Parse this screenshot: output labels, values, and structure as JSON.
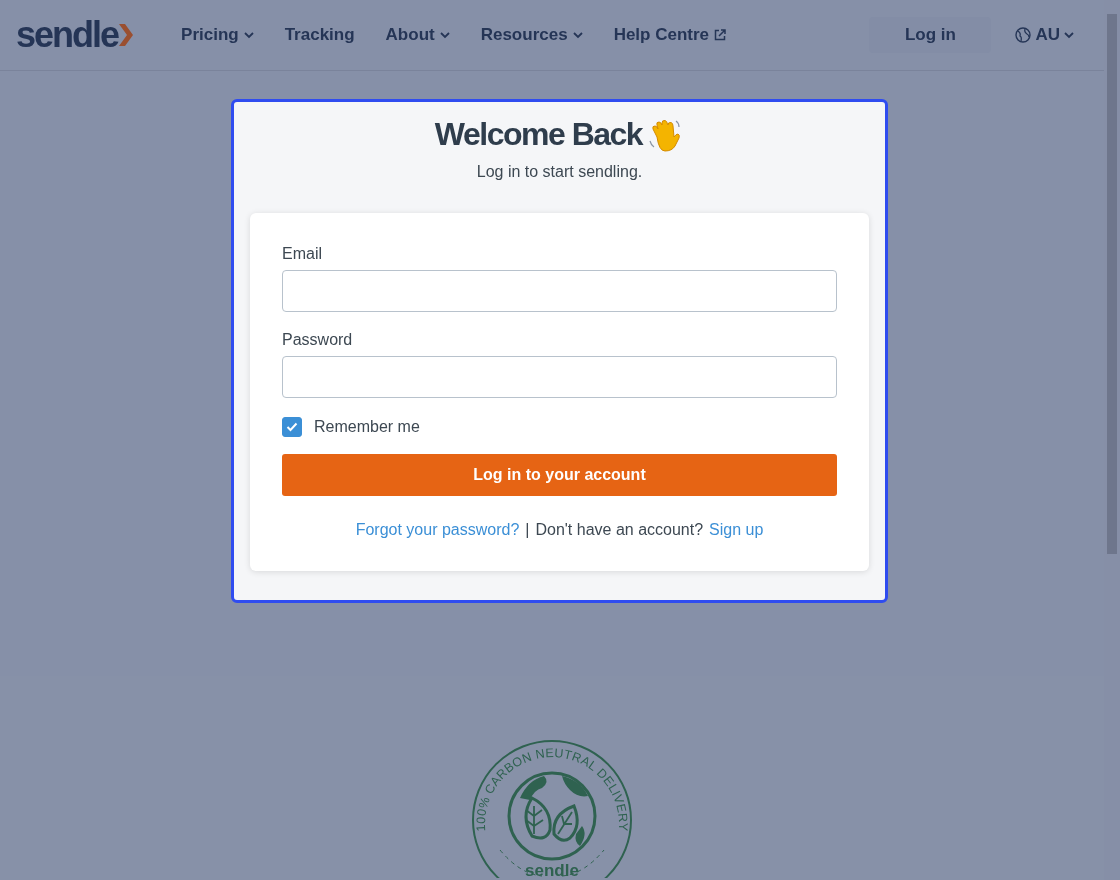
{
  "header": {
    "logo": "sendle",
    "nav": [
      {
        "label": "Pricing",
        "kind": "dropdown"
      },
      {
        "label": "Tracking",
        "kind": "link"
      },
      {
        "label": "About",
        "kind": "dropdown"
      },
      {
        "label": "Resources",
        "kind": "dropdown"
      },
      {
        "label": "Help Centre",
        "kind": "external"
      }
    ],
    "login": "Log in",
    "region": "AU"
  },
  "modal": {
    "title": "Welcome Back",
    "subtitle": "Log in to start sendling.",
    "fields": [
      {
        "label": "Email"
      },
      {
        "label": "Password"
      }
    ],
    "remember": {
      "label": "Remember me",
      "checked": true
    },
    "submit": "Log in to your account",
    "footer": {
      "forgot": "Forgot your password?",
      "separator": "|",
      "prompt": "Don't have an account?",
      "signup": "Sign up"
    }
  },
  "badge": {
    "text": "100% CARBON NEUTRAL DELIVERY",
    "logo": "sendle"
  }
}
